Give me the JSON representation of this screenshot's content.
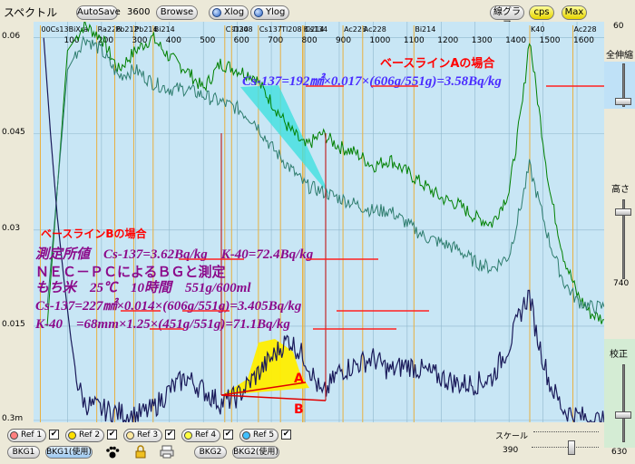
{
  "toolbar": {
    "title": "スペクトル",
    "autosave_label": "AutoSave",
    "channel_value": "3600",
    "browse_label": "Browse",
    "xlog_label": "Xlog",
    "ylog_label": "Ylog",
    "linegraph_label": "線グラフ",
    "cps_label": "cps",
    "max_label": "Max"
  },
  "right_panel": {
    "top_value": "60",
    "zoom_label": "全伸縮",
    "height_label": "高さ",
    "height_value": "740",
    "calib_label": "校正",
    "calib_value": "630"
  },
  "bottom": {
    "refs": [
      {
        "label": "Ref 1",
        "color": "#ff8080",
        "checked": "✔"
      },
      {
        "label": "Ref 2",
        "color": "#ffe000",
        "checked": "✔"
      },
      {
        "label": "Ref 3",
        "color": "#ffe9a0",
        "checked": "✔"
      },
      {
        "label": "Ref 4",
        "color": "#ffff40",
        "checked": "✔"
      },
      {
        "label": "Ref 5",
        "color": "#40c0ff",
        "checked": "✔"
      }
    ],
    "bkg1_label": "BKG1",
    "bkg1_use_label": "BKG1(使用)",
    "bkg2_label": "BKG2",
    "bkg2_use_label": "BKG2(使用)",
    "scale_label": "スケール",
    "scale_value": "390"
  },
  "chart_data": {
    "type": "line",
    "y_tick_labels": [
      "0.06",
      "0.045",
      "0.03",
      "0.015",
      "0.3m"
    ],
    "y_ticks": [
      0.06,
      0.045,
      0.03,
      0.015,
      0.0003
    ],
    "ylim": [
      0,
      0.0625
    ],
    "xlim": [
      0,
      1680
    ],
    "x_ticks": [
      100,
      200,
      300,
      400,
      500,
      600,
      700,
      800,
      900,
      1000,
      1100,
      1200,
      1300,
      1400,
      1500,
      1600
    ],
    "nuclide_labels": [
      {
        "text": "00Cs13BiXra",
        "x": 20
      },
      {
        "text": "Ra226",
        "x": 186
      },
      {
        "text": "Pb212",
        "x": 239
      },
      {
        "text": "Pb214",
        "x": 295
      },
      {
        "text": "Bi214",
        "x": 352
      },
      {
        "text": "Cs134",
        "x": 563
      },
      {
        "text": "Tl208",
        "x": 583
      },
      {
        "text": "Tl208",
        "x": 727
      },
      {
        "text": "Bi214",
        "x": 792
      },
      {
        "text": "Cs137",
        "x": 662
      },
      {
        "text": "Cs134",
        "x": 796
      },
      {
        "text": "Ac228",
        "x": 911
      },
      {
        "text": "Ac228",
        "x": 969
      },
      {
        "text": "Bi214",
        "x": 1120
      },
      {
        "text": "K40",
        "x": 1461
      },
      {
        "text": "Ac228",
        "x": 1588
      }
    ],
    "series": [
      {
        "color": "#008000",
        "values": [
          [
            40,
            0.015
          ],
          [
            100,
            0.058
          ],
          [
            150,
            0.062
          ],
          [
            200,
            0.06
          ],
          [
            250,
            0.055
          ],
          [
            300,
            0.058
          ],
          [
            350,
            0.06
          ],
          [
            400,
            0.057
          ],
          [
            450,
            0.055
          ],
          [
            500,
            0.052
          ],
          [
            550,
            0.056
          ],
          [
            600,
            0.055
          ],
          [
            650,
            0.054
          ],
          [
            700,
            0.05
          ],
          [
            750,
            0.046
          ],
          [
            800,
            0.043
          ],
          [
            850,
            0.045
          ],
          [
            900,
            0.043
          ],
          [
            950,
            0.042
          ],
          [
            1000,
            0.04
          ],
          [
            1050,
            0.041
          ],
          [
            1100,
            0.039
          ],
          [
            1150,
            0.037
          ],
          [
            1200,
            0.035
          ],
          [
            1250,
            0.034
          ],
          [
            1300,
            0.032
          ],
          [
            1350,
            0.031
          ],
          [
            1400,
            0.036
          ],
          [
            1440,
            0.05
          ],
          [
            1460,
            0.06
          ],
          [
            1480,
            0.052
          ],
          [
            1520,
            0.036
          ],
          [
            1560,
            0.026
          ],
          [
            1600,
            0.02
          ],
          [
            1640,
            0.017
          ],
          [
            1680,
            0.016
          ]
        ]
      },
      {
        "color": "#2e7d6e",
        "values": [
          [
            40,
            0.018
          ],
          [
            100,
            0.055
          ],
          [
            150,
            0.06
          ],
          [
            200,
            0.058
          ],
          [
            250,
            0.054
          ],
          [
            300,
            0.055
          ],
          [
            350,
            0.053
          ],
          [
            400,
            0.052
          ],
          [
            450,
            0.052
          ],
          [
            500,
            0.051
          ],
          [
            550,
            0.05
          ],
          [
            600,
            0.049
          ],
          [
            650,
            0.047
          ],
          [
            700,
            0.043
          ],
          [
            750,
            0.04
          ],
          [
            800,
            0.037
          ],
          [
            850,
            0.036
          ],
          [
            900,
            0.035
          ],
          [
            950,
            0.034
          ],
          [
            1000,
            0.033
          ],
          [
            1050,
            0.033
          ],
          [
            1100,
            0.031
          ],
          [
            1150,
            0.029
          ],
          [
            1200,
            0.028
          ],
          [
            1250,
            0.027
          ],
          [
            1300,
            0.025
          ],
          [
            1350,
            0.024
          ],
          [
            1400,
            0.026
          ],
          [
            1440,
            0.035
          ],
          [
            1460,
            0.04
          ],
          [
            1480,
            0.036
          ],
          [
            1520,
            0.028
          ],
          [
            1560,
            0.022
          ],
          [
            1600,
            0.019
          ],
          [
            1640,
            0.018
          ],
          [
            1680,
            0.018
          ]
        ]
      },
      {
        "color": "#1a1a5a",
        "values": [
          [
            30,
            0.06
          ],
          [
            50,
            0.045
          ],
          [
            70,
            0.032
          ],
          [
            90,
            0.022
          ],
          [
            110,
            0.013
          ],
          [
            130,
            0.006
          ],
          [
            150,
            0.003
          ],
          [
            200,
            0.002
          ],
          [
            300,
            0.001
          ],
          [
            350,
            0.002
          ],
          [
            400,
            0.005
          ],
          [
            450,
            0.007
          ],
          [
            500,
            0.005
          ],
          [
            550,
            0.003
          ],
          [
            600,
            0.004
          ],
          [
            650,
            0.007
          ],
          [
            700,
            0.01
          ],
          [
            750,
            0.013
          ],
          [
            800,
            0.01
          ],
          [
            850,
            0.004
          ],
          [
            900,
            0.008
          ],
          [
            950,
            0.009
          ],
          [
            1000,
            0.01
          ],
          [
            1050,
            0.008
          ],
          [
            1100,
            0.009
          ],
          [
            1150,
            0.008
          ],
          [
            1200,
            0.007
          ],
          [
            1250,
            0.006
          ],
          [
            1300,
            0.006
          ],
          [
            1350,
            0.007
          ],
          [
            1400,
            0.012
          ],
          [
            1440,
            0.018
          ],
          [
            1460,
            0.02
          ],
          [
            1480,
            0.014
          ],
          [
            1520,
            0.006
          ],
          [
            1560,
            0.002
          ],
          [
            1600,
            0.001
          ],
          [
            1680,
            0
          ]
        ]
      }
    ],
    "annotations": [
      {
        "text": "ベースラインAの場合",
        "color": "#ff0000"
      },
      {
        "text": "Cs-137=192㎟×0.017×(606g/551g)=3.58Bq/kg",
        "color": "#4a2cff"
      },
      {
        "text": "ベースラインBの場合",
        "color": "#ff0000"
      },
      {
        "text": "測定所値　Cs-137=3.62Bq/kg　K-40=72.4Bq/kg",
        "color": "#8b0a8b"
      },
      {
        "text": "ＮＥＣ－ＰＣによるＢＧと測定",
        "color": "#8b0a8b"
      },
      {
        "text": "もち米　25℃　10時間　551g/600ml",
        "color": "#8b0a8b"
      },
      {
        "text": "Cs-137=227㎟×0.014×(606g/551g)=3.405Bq/kg",
        "color": "#8b0a8b"
      },
      {
        "text": "K-40　=68mm×1.25×(451g/551g)=71.1Bq/kg",
        "color": "#8b0a8b"
      },
      {
        "text": "A",
        "color": "#ff0000"
      },
      {
        "text": "B",
        "color": "#ff0000"
      }
    ]
  }
}
